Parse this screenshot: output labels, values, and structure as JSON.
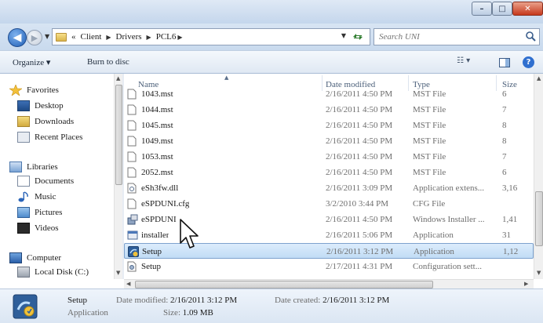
{
  "window": {
    "caption": {
      "minimize": "–",
      "maximize": "□",
      "close": "✕"
    }
  },
  "address": {
    "overflow": "«",
    "crumbs": [
      "Client",
      "Drivers",
      "PCL6"
    ],
    "search_placeholder": "Search UNI"
  },
  "toolbar": {
    "organize": "Organize ▾",
    "burn": "Burn to disc"
  },
  "nav": {
    "favorites": "Favorites",
    "desktop": "Desktop",
    "downloads": "Downloads",
    "recent": "Recent Places",
    "libraries": "Libraries",
    "documents": "Documents",
    "music": "Music",
    "pictures": "Pictures",
    "videos": "Videos",
    "computer": "Computer",
    "local_disk": "Local Disk (C:)"
  },
  "columns": {
    "name": "Name",
    "date": "Date modified",
    "type": "Type",
    "size": "Size"
  },
  "files": [
    {
      "name": "1043.mst",
      "date": "2/16/2011 4:50 PM",
      "type": "MST File",
      "size": "6",
      "icon": "file-icon"
    },
    {
      "name": "1044.mst",
      "date": "2/16/2011 4:50 PM",
      "type": "MST File",
      "size": "7",
      "icon": "file-icon"
    },
    {
      "name": "1045.mst",
      "date": "2/16/2011 4:50 PM",
      "type": "MST File",
      "size": "8",
      "icon": "file-icon"
    },
    {
      "name": "1049.mst",
      "date": "2/16/2011 4:50 PM",
      "type": "MST File",
      "size": "8",
      "icon": "file-icon"
    },
    {
      "name": "1053.mst",
      "date": "2/16/2011 4:50 PM",
      "type": "MST File",
      "size": "7",
      "icon": "file-icon"
    },
    {
      "name": "2052.mst",
      "date": "2/16/2011 4:50 PM",
      "type": "MST File",
      "size": "6",
      "icon": "file-icon"
    },
    {
      "name": "eSh3fw.dll",
      "date": "2/16/2011 3:09 PM",
      "type": "Application extens...",
      "size": "3,16",
      "icon": "dll-icon"
    },
    {
      "name": "eSPDUNI.cfg",
      "date": "3/2/2010 3:44 PM",
      "type": "CFG File",
      "size": "",
      "icon": "file-icon"
    },
    {
      "name": "eSPDUNI",
      "date": "2/16/2011 4:50 PM",
      "type": "Windows Installer ...",
      "size": "1,41",
      "icon": "installer-package-icon"
    },
    {
      "name": "installer",
      "date": "2/16/2011 5:06 PM",
      "type": "Application",
      "size": "31",
      "icon": "application-icon"
    },
    {
      "name": "Setup",
      "date": "2/16/2011 3:12 PM",
      "type": "Application",
      "size": "1,12",
      "icon": "setup-app-icon",
      "selected": true
    },
    {
      "name": "Setup",
      "date": "2/17/2011 4:31 PM",
      "type": "Configuration sett...",
      "size": "",
      "icon": "config-file-icon"
    }
  ],
  "details": {
    "name": "Setup",
    "type": "Application",
    "modified_label": "Date modified:",
    "modified_value": "2/16/2011 3:12 PM",
    "created_label": "Date created:",
    "created_value": "2/16/2011 3:12 PM",
    "size_label": "Size:",
    "size_value": "1.09 MB"
  },
  "colors": {
    "selection": "#cde3f9",
    "titlebar": "#c4d6ec",
    "close": "#c7381c"
  }
}
